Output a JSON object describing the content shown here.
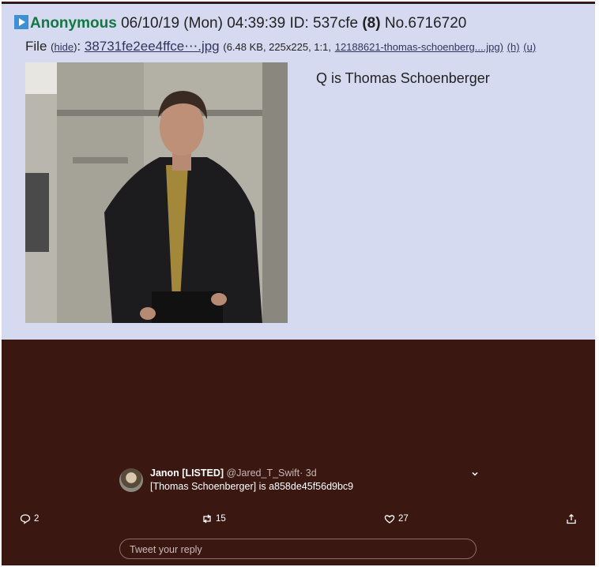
{
  "post": {
    "name": "Anonymous",
    "datetime": "06/10/19 (Mon) 04:39:39",
    "id_label": "ID:",
    "poster_id": "537cfe",
    "reply_count": "(8)",
    "post_number": "No.6716720",
    "file_label": "File",
    "hide_link": "hide",
    "filename": "38731fe2ee4ffce⋯.jpg",
    "file_meta": "(6.48 KB, 225x225, 1:1,",
    "original_filename": "12188621-thomas-schoenberg....jpg)",
    "link_h": "(h)",
    "link_u": "(u)",
    "message": "Q is Thomas Schoenberger"
  },
  "tweet": {
    "display_name": "Janon [LISTED]",
    "handle": "@Jared_T_Swift",
    "age": "· 3d",
    "text": "[Thomas Schoenberger] is a858de45f56d9bc9",
    "reply_count": "2",
    "retweet_count": "15",
    "like_count": "27",
    "reply_placeholder": "Tweet your reply"
  },
  "colors": {
    "post_background": "#d6daf0",
    "name_green": "#117743",
    "link_blue": "#34345c",
    "tweet_background": "#3a1711"
  },
  "icons": [
    "arrow-icon",
    "chevron-down-icon",
    "reply-icon",
    "retweet-icon",
    "like-icon",
    "share-icon"
  ]
}
